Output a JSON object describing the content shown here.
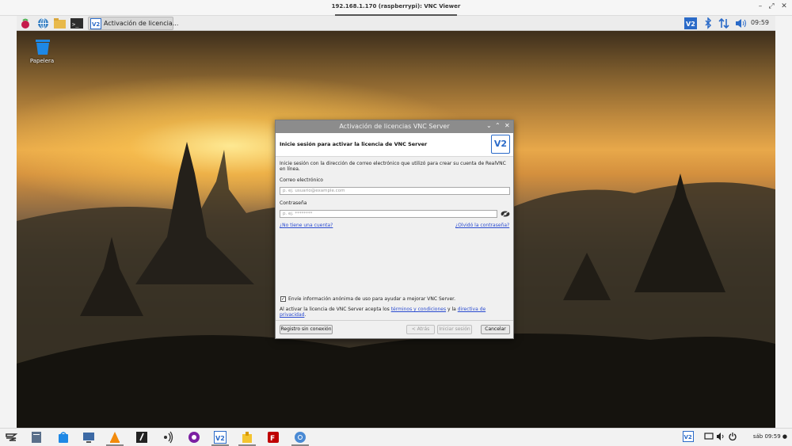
{
  "vnc_viewer": {
    "title": "192.168.1.170 (raspberrypi): VNC Viewer",
    "controls": {
      "minimize": "–",
      "restore": "⤢",
      "close": "✕"
    }
  },
  "panel": {
    "task_button_label": "Activación de licencia...",
    "clock": "09:59",
    "icons": [
      "raspberry-menu-icon",
      "web-browser-icon",
      "file-manager-icon",
      "terminal-icon",
      "vnc-server-icon",
      "bluetooth-icon",
      "network-icon",
      "volume-icon"
    ]
  },
  "desktop": {
    "trash_label": "Papelera"
  },
  "dialog": {
    "title": "Activación de licencias VNC Server",
    "heading": "Inicie sesión para activar la licencia de VNC Server",
    "logo_text": "V2",
    "intro_line1": "Inicie sesión con la dirección de correo electrónico que utilizó para crear su cuenta de RealVNC",
    "intro_line2": "en línea.",
    "email_label": "Correo electrónico",
    "email_placeholder": "p. ej. usuario@example.com",
    "password_label": "Contraseña",
    "password_placeholder": "p. ej. ********",
    "no_account_link": "¿No tiene una cuenta?",
    "forgot_link": "¿Olvidó la contraseña?",
    "anon_checkbox_checked": true,
    "anon_checkbox_label": "Envíe información anónima de uso para ayudar a mejorar VNC Server.",
    "terms_prefix": "Al activar la licencia de VNC Server acepta los",
    "terms_link": "términos y condiciones",
    "terms_middle": "y la",
    "privacy_link_1": "directiva de",
    "privacy_link_2": "privacidad",
    "terms_suffix": ".",
    "offline_button": "Registro sin conexión",
    "back_button": "< Atrás",
    "signin_button": "Iniciar sesión",
    "cancel_button": "Cancelar"
  },
  "taskbar": {
    "clock": "sáb 09:59 ●"
  }
}
